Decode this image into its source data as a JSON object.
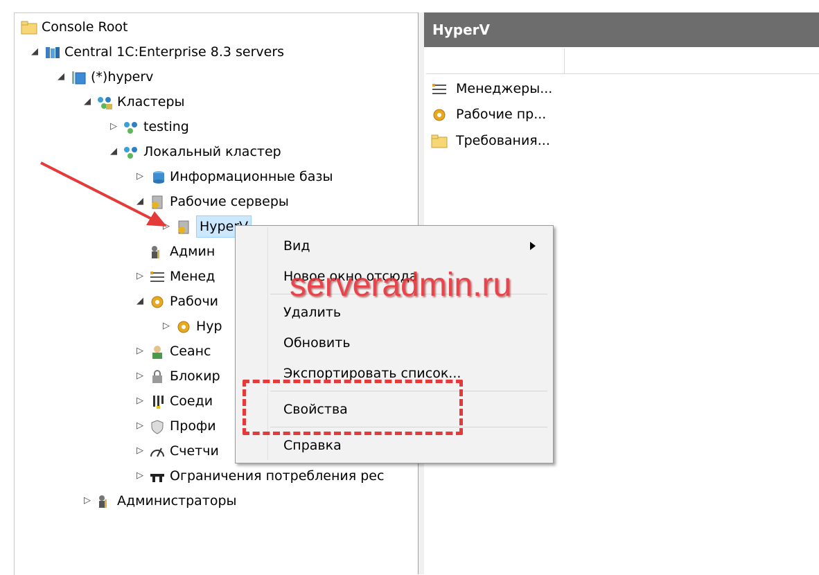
{
  "tree": {
    "console_root": "Console Root",
    "server_group": "Central 1C:Enterprise 8.3 servers",
    "server": "(*)hyperv",
    "clusters": "Кластеры",
    "cluster_testing": "testing",
    "cluster_local": "Локальный кластер",
    "infobases": "Информационные базы",
    "work_servers": "Рабочие серверы",
    "hyperv_node": "HyperV",
    "admins_cluster": "Админ",
    "managers": "Менед",
    "processes": "Рабочи",
    "process_hyper": "Hyp",
    "sessions": "Сеанс",
    "locks": "Блокир",
    "connections": "Соеди",
    "profiles": "Профи",
    "counters": "Счетчи",
    "limits": "Ограничения потребления рес",
    "admins_root": "Администраторы"
  },
  "right_panel": {
    "title": "HyperV",
    "items": [
      "Менеджеры...",
      "Рабочие пр...",
      "Требования..."
    ]
  },
  "context_menu": {
    "view": "Вид",
    "new_window": "Новое окно отсюда",
    "delete": "Удалить",
    "refresh": "Обновить",
    "export": "Экспортировать список...",
    "properties": "Свойства",
    "help": "Справка"
  },
  "watermark": "serveradmin.ru",
  "colors": {
    "selection": "#cce8ff",
    "header": "#6d6d6d",
    "annotation": "#e53a3a"
  }
}
